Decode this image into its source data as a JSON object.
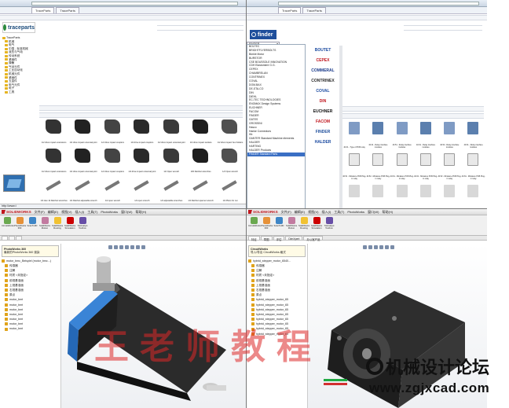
{
  "top_left": {
    "tabs": [
      "TraceParts",
      "TraceParts"
    ],
    "brand": "traceparts",
    "tree": [
      "TraceParts",
      "机械",
      "电气",
      "中国 - 标准机械",
      "液压与气动",
      "传动系统",
      "紧固件",
      "弹簧",
      "气动元件",
      "工业自动化",
      "机械元件",
      "紧固件",
      "五金件",
      "电气元件",
      "电子",
      "工具"
    ],
    "parts_grid": [
      [
        "1/2 drive impact extensions",
        "1/2 drive impact universal joint",
        "1/2 drive impact couplers",
        "1/2 drive impact couplers",
        "1/2 drive impact universal joint",
        "1/2 drive impact sockets",
        "1/2 drive impact hex holders"
      ],
      [
        "1/2 drive impact extensions",
        "1/2 drive impact universal joint",
        "1/2 drive impact couplers",
        "1/2 drive impact universal joint",
        "1/2 Open wrench",
        "100 Ratchet wrenches",
        "1/2 Open wrench",
        "1/2 Chrome adjustable wrenches"
      ],
      [
        "1/4 Hex 12 Ratchet wrenches",
        "1/2 Ratchet adjustable wrench",
        "1/2 open wrench",
        "1/4 open wrench",
        "1/4 adjustable wrenches",
        "1/2 Ratchet spanner wrench",
        "1/2 Pliers for nut"
      ]
    ],
    "status": "http://www.t"
  },
  "top_right": {
    "tabs": [
      "TraceParts",
      "TraceParts"
    ],
    "brand": "finder",
    "dropdown_selected": "FINDER",
    "dropdown": [
      "BOLTEC",
      "BRIGHTFLYERBOLTS",
      "Bürkle Motor",
      "BURSTOR",
      "CSE BOUSSOLE INNOVATION",
      "CDH Elastomere G.G.",
      "CEPEX",
      "CHAMBRELAN",
      "CONTRINEX",
      "COVAL",
      "DOM-BAX",
      "DE-STA-CO",
      "DIN",
      "DIEHL",
      "EC-TEC TECHNOLOGIES",
      "ENOMAX Design Systems",
      "EUCHNER",
      "FACOM",
      "FINDER",
      "GATES",
      "GROSSINI",
      "Hasco",
      "Hanke Connectors",
      "Hb",
      "GANTER Standard Machine elements",
      "HALDER",
      "HARTING",
      "HALDER Products",
      "FINDER Standard Parts"
    ],
    "logos": [
      "BOUTET",
      "CEPEX",
      "COMMERAL",
      "CONTRINEX",
      "COVAL",
      "DIN",
      "EUCHNER",
      "FACOM",
      "FINDER",
      "HALDER"
    ],
    "parts_grid": [
      [
        "40.31 - Type of PCB relay",
        "40.31 - Relay interface modules",
        "40.51 - Relay interface modules",
        "40.61 - Relay interface modules",
        "40.52 - Relay interface modules",
        "40.61 - Relay interface modules"
      ],
      [
        "40.51 - Miniature PCB Plug-in relay",
        "40.52 - Miniature PCB Plug-in relay",
        "40.61 - Miniature PCB Plug-in relay",
        "40.61 - Miniature PCB Plug-in relay",
        "40.52 - Miniature PCB Plug-in relay",
        "40.61 - Miniature PCB Plug-in relay"
      ],
      [
        "40.52 Bistable versions",
        "40.52 - Miniature PCB",
        "40.61 - Miniature PCB",
        "40.61 Bistable versions",
        "40.52 Bistable versions",
        "40.61 Bistable versions"
      ]
    ]
  },
  "bottom_left": {
    "app": "SOLIDWORKS",
    "menus": [
      "文件(F)",
      "编辑(E)",
      "视图(V)",
      "插入(I)",
      "工具(T)",
      "PhotoWorks",
      "窗口(W)",
      "帮助(H)"
    ],
    "ribbon": [
      "CircuitWorks",
      "PhotoWorks 360",
      "ScanTo3D",
      "SolidWorks Motion",
      "SolidWorks Routing",
      "SolidWorks Simulation",
      "TolAnalyst Toolbox"
    ],
    "sidebar_heading": "PhotoWorks 360",
    "sidebar_sub": "最新的PhotoWorks 360 渲染",
    "tree": [
      "motor_bmc_Beispiel (motor_bmc...)",
      "传感器",
      "注解",
      "材质 <未指定>",
      "前视基准面",
      "上视基准面",
      "右视基准面",
      "原点",
      "motor_bmt",
      "motor_bmt",
      "motor_bmt",
      "motor_bmt",
      "motor_bmt",
      "motor_bmt",
      "motor_bmt"
    ],
    "colors": {
      "motor_body": "#2b2b2b",
      "motor_cap": "#3a84d6",
      "connector": "#b8b8b8"
    }
  },
  "bottom_right": {
    "app": "SOLIDWORKS",
    "menus": [
      "文件(F)",
      "编辑(E)",
      "视图(V)",
      "插入(I)",
      "工具(T)",
      "PhotoWorks",
      "窗口(W)",
      "帮助(H)"
    ],
    "ribbon": [
      "CircuitWorks",
      "PhotoWorks 360",
      "ScanTo3D",
      "SolidWorks Motion",
      "SolidWorks Routing",
      "SolidWorks Simulation",
      "TolAnalyst Toolbox"
    ],
    "tabs": [
      "特征",
      "草图",
      "评估",
      "DimXpert",
      "办公室产品"
    ],
    "sidebar_heading": "CircuitWorks",
    "sidebar_sub": "导入/导出 CircuitWorks 格式",
    "tree": [
      "hybrid_stepper_motor_6540...",
      "传感器",
      "注解",
      "材质 <未指定>",
      "前视基准面",
      "上视基准面",
      "右视基准面",
      "原点",
      "hybrid_stepper_motor_65",
      "hybrid_stepper_motor_65",
      "hybrid_stepper_motor_65",
      "hybrid_stepper_motor_65",
      "hybrid_stepper_motor_65",
      "hybrid_stepper_motor_65",
      "hybrid_stepper_motor_65",
      "hybrid_stepper_motor_65"
    ],
    "colors": {
      "motor_body": "#2e2e2e",
      "wire_green": "#22aa44",
      "wire_red": "#d23030"
    }
  },
  "watermark": "王老师教程",
  "forum_name": "机械设计论坛",
  "forum_url": "www.zgjxcad.com"
}
